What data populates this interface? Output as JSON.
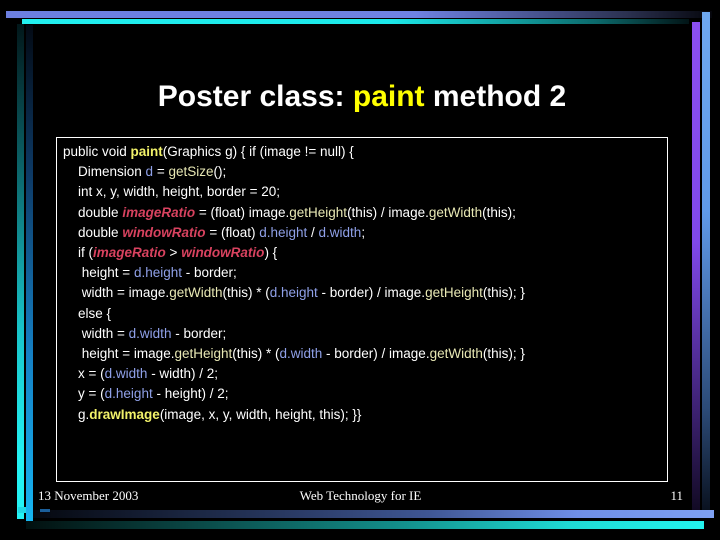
{
  "slide": {
    "title_prefix": "Poster class: ",
    "title_highlight": "paint",
    "title_suffix": " method 2",
    "title_full": "Poster class: paint method 2",
    "background_color": "#000000",
    "highlight_color": "#ffff00",
    "title_color": "#ffffff"
  },
  "code": {
    "language": "java",
    "border_color": "#ffffff",
    "colors": {
      "plain": "#ffffff",
      "keyword_bold_yellow": "#f2f26a",
      "identifier_blue": "#8fa0e8",
      "ratio_pink_italic": "#d8425f",
      "method_pale_yellow": "#e8e8b4"
    },
    "lines": [
      {
        "indent": 0,
        "tokens": [
          {
            "t": "public void ",
            "c": "kw"
          },
          {
            "t": "paint",
            "c": "bold-y"
          },
          {
            "t": "(Graphics g) { if (image != null) {",
            "c": "kw"
          }
        ]
      },
      {
        "indent": 1,
        "tokens": [
          {
            "t": "Dimension ",
            "c": "kw"
          },
          {
            "t": "d",
            "c": "ident-b"
          },
          {
            "t": " = ",
            "c": "kw"
          },
          {
            "t": "getSize",
            "c": "meth"
          },
          {
            "t": "();",
            "c": "kw"
          }
        ]
      },
      {
        "indent": 1,
        "tokens": [
          {
            "t": "int x, y, width, height, border = 20;",
            "c": "kw"
          }
        ]
      },
      {
        "indent": 1,
        "tokens": [
          {
            "t": "double ",
            "c": "kw"
          },
          {
            "t": "imageRatio",
            "c": "ratio"
          },
          {
            "t": " = (float) image.",
            "c": "kw"
          },
          {
            "t": "getHeight",
            "c": "meth"
          },
          {
            "t": "(this) / image.",
            "c": "kw"
          },
          {
            "t": "getWidth",
            "c": "meth"
          },
          {
            "t": "(this);",
            "c": "kw"
          }
        ]
      },
      {
        "indent": 1,
        "tokens": [
          {
            "t": "double ",
            "c": "kw"
          },
          {
            "t": "windowRatio",
            "c": "ratio"
          },
          {
            "t": " = (float) ",
            "c": "kw"
          },
          {
            "t": "d.height",
            "c": "ident-b"
          },
          {
            "t": " / ",
            "c": "kw"
          },
          {
            "t": "d.width",
            "c": "ident-b"
          },
          {
            "t": ";",
            "c": "kw"
          }
        ]
      },
      {
        "indent": 1,
        "tokens": [
          {
            "t": "if (",
            "c": "kw"
          },
          {
            "t": "imageRatio",
            "c": "ratio"
          },
          {
            "t": " > ",
            "c": "kw"
          },
          {
            "t": "windowRatio",
            "c": "ratio"
          },
          {
            "t": ") {",
            "c": "kw"
          }
        ]
      },
      {
        "indent": 2,
        "tokens": [
          {
            "t": "height = ",
            "c": "kw"
          },
          {
            "t": "d.height",
            "c": "ident-b"
          },
          {
            "t": " - border;",
            "c": "kw"
          }
        ]
      },
      {
        "indent": 2,
        "tokens": [
          {
            "t": "width = image.",
            "c": "kw"
          },
          {
            "t": "getWidth",
            "c": "meth"
          },
          {
            "t": "(this) * (",
            "c": "kw"
          },
          {
            "t": "d.height",
            "c": "ident-b"
          },
          {
            "t": " - border) / image.",
            "c": "kw"
          },
          {
            "t": "getHeight",
            "c": "meth"
          },
          {
            "t": "(this); }",
            "c": "kw"
          }
        ]
      },
      {
        "indent": 1,
        "tokens": [
          {
            "t": "else {",
            "c": "kw"
          }
        ]
      },
      {
        "indent": 2,
        "tokens": [
          {
            "t": "width = ",
            "c": "kw"
          },
          {
            "t": "d.width",
            "c": "ident-b"
          },
          {
            "t": " - border;",
            "c": "kw"
          }
        ]
      },
      {
        "indent": 2,
        "tokens": [
          {
            "t": "height = image.",
            "c": "kw"
          },
          {
            "t": "getHeight",
            "c": "meth"
          },
          {
            "t": "(this) * (",
            "c": "kw"
          },
          {
            "t": "d.width",
            "c": "ident-b"
          },
          {
            "t": " - border) / image.",
            "c": "kw"
          },
          {
            "t": "getWidth",
            "c": "meth"
          },
          {
            "t": "(this); }",
            "c": "kw"
          }
        ]
      },
      {
        "indent": 1,
        "tokens": [
          {
            "t": "x = (",
            "c": "kw"
          },
          {
            "t": "d.width",
            "c": "ident-b"
          },
          {
            "t": " - width) / 2;",
            "c": "kw"
          }
        ]
      },
      {
        "indent": 1,
        "tokens": [
          {
            "t": "y = (",
            "c": "kw"
          },
          {
            "t": "d.height",
            "c": "ident-b"
          },
          {
            "t": " - height) / 2;",
            "c": "kw"
          }
        ]
      },
      {
        "indent": 1,
        "tokens": [
          {
            "t": "g.",
            "c": "kw"
          },
          {
            "t": "drawImage",
            "c": "bold-y"
          },
          {
            "t": "(image, x, y, width, height, this); }}",
            "c": "kw"
          }
        ]
      }
    ]
  },
  "footer": {
    "date": "13 November 2003",
    "center": "Web Technology for IE",
    "page_number": "11"
  }
}
